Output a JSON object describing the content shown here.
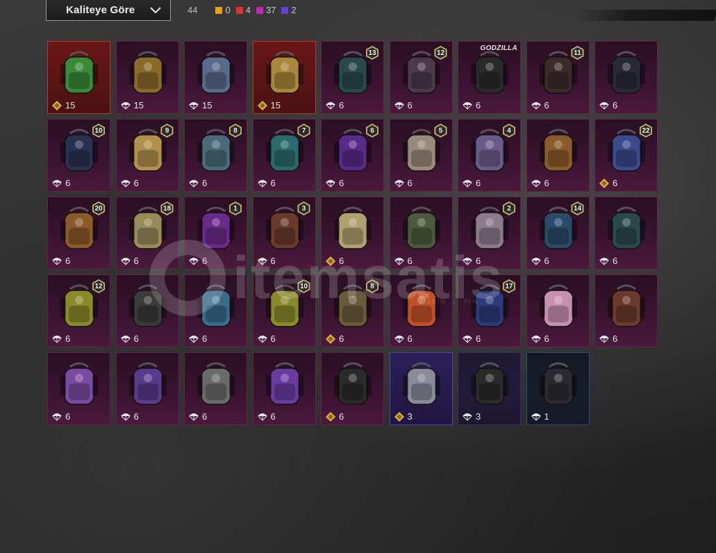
{
  "toolbar": {
    "sort_label": "Kaliteye Göre",
    "total_count": "44",
    "quality_counts": [
      {
        "color": "#e6a21a",
        "count": "0"
      },
      {
        "color": "#e03030",
        "count": "4"
      },
      {
        "color": "#c02ab8",
        "count": "37"
      },
      {
        "color": "#6a3cd8",
        "count": "2"
      }
    ]
  },
  "watermark": {
    "text": "itemsatis",
    "sub": "/ SKIN … -PIN"
  },
  "items": [
    {
      "rarity": "mythic",
      "count": "15",
      "footer_icon": "gold-coin-icon",
      "level": "",
      "label": "",
      "bag_color": "#3a8a3a"
    },
    {
      "rarity": "pink",
      "count": "15",
      "footer_icon": "parachute-icon",
      "level": "",
      "label": "",
      "bag_color": "#8a6a2a"
    },
    {
      "rarity": "pink",
      "count": "15",
      "footer_icon": "parachute-icon",
      "level": "",
      "label": "",
      "bag_color": "#5a6a8a"
    },
    {
      "rarity": "mythic",
      "count": "15",
      "footer_icon": "gold-coin-icon",
      "level": "",
      "label": "",
      "bag_color": "#a8893a"
    },
    {
      "rarity": "pink",
      "count": "6",
      "footer_icon": "parachute-icon",
      "level": "13",
      "label": "",
      "bag_color": "#2a4a4a"
    },
    {
      "rarity": "pink",
      "count": "6",
      "footer_icon": "parachute-icon",
      "level": "12",
      "label": "",
      "bag_color": "#4a3a4a"
    },
    {
      "rarity": "pink",
      "count": "6",
      "footer_icon": "parachute-icon",
      "level": "",
      "label": "GODZILLA",
      "bag_color": "#2a2a2a"
    },
    {
      "rarity": "pink",
      "count": "6",
      "footer_icon": "parachute-icon",
      "level": "11",
      "label": "",
      "bag_color": "#3a2a2a"
    },
    {
      "rarity": "pink",
      "count": "6",
      "footer_icon": "parachute-icon",
      "level": "",
      "label": "",
      "bag_color": "#2a2a34"
    },
    {
      "rarity": "pink",
      "count": "6",
      "footer_icon": "parachute-icon",
      "level": "10",
      "label": "",
      "bag_color": "#2a3050"
    },
    {
      "rarity": "pink",
      "count": "6",
      "footer_icon": "parachute-icon",
      "level": "9",
      "label": "",
      "bag_color": "#b0904a"
    },
    {
      "rarity": "pink",
      "count": "6",
      "footer_icon": "parachute-icon",
      "level": "8",
      "label": "",
      "bag_color": "#4a6a7a"
    },
    {
      "rarity": "pink",
      "count": "6",
      "footer_icon": "parachute-icon",
      "level": "7",
      "label": "",
      "bag_color": "#2a6a6a"
    },
    {
      "rarity": "pink",
      "count": "6",
      "footer_icon": "parachute-icon",
      "level": "6",
      "label": "",
      "bag_color": "#5a2a8a"
    },
    {
      "rarity": "pink",
      "count": "6",
      "footer_icon": "parachute-icon",
      "level": "5",
      "label": "",
      "bag_color": "#9a8a7a"
    },
    {
      "rarity": "pink",
      "count": "6",
      "footer_icon": "parachute-icon",
      "level": "4",
      "label": "",
      "bag_color": "#6a5a8a"
    },
    {
      "rarity": "pink",
      "count": "6",
      "footer_icon": "parachute-icon",
      "level": "",
      "label": "",
      "bag_color": "#8a5a2a"
    },
    {
      "rarity": "pink",
      "count": "6",
      "footer_icon": "gold-coin-icon",
      "level": "22",
      "label": "",
      "bag_color": "#3a4a8a"
    },
    {
      "rarity": "pink",
      "count": "6",
      "footer_icon": "parachute-icon",
      "level": "20",
      "label": "",
      "bag_color": "#8a5a2a"
    },
    {
      "rarity": "pink",
      "count": "6",
      "footer_icon": "parachute-icon",
      "level": "18",
      "label": "",
      "bag_color": "#9a8a5a"
    },
    {
      "rarity": "pink",
      "count": "6",
      "footer_icon": "parachute-icon",
      "level": "1",
      "label": "",
      "bag_color": "#6a2a8a"
    },
    {
      "rarity": "pink",
      "count": "6",
      "footer_icon": "parachute-icon",
      "level": "3",
      "label": "",
      "bag_color": "#6a3a2a"
    },
    {
      "rarity": "pink",
      "count": "6",
      "footer_icon": "gold-coin-icon",
      "level": "",
      "label": "",
      "bag_color": "#b0a070"
    },
    {
      "rarity": "pink",
      "count": "6",
      "footer_icon": "parachute-icon",
      "level": "",
      "label": "",
      "bag_color": "#4a5a3a"
    },
    {
      "rarity": "pink",
      "count": "6",
      "footer_icon": "parachute-icon",
      "level": "2",
      "label": "",
      "bag_color": "#8a7a8a"
    },
    {
      "rarity": "pink",
      "count": "6",
      "footer_icon": "parachute-icon",
      "level": "14",
      "label": "",
      "bag_color": "#2a4a6a"
    },
    {
      "rarity": "pink",
      "count": "6",
      "footer_icon": "parachute-icon",
      "level": "",
      "label": "",
      "bag_color": "#2a4a4a"
    },
    {
      "rarity": "pink",
      "count": "6",
      "footer_icon": "parachute-icon",
      "level": "12",
      "label": "",
      "bag_color": "#8a8a2a"
    },
    {
      "rarity": "pink",
      "count": "6",
      "footer_icon": "parachute-icon",
      "level": "",
      "label": "",
      "bag_color": "#3a3a3a"
    },
    {
      "rarity": "pink",
      "count": "6",
      "footer_icon": "parachute-icon",
      "level": "",
      "label": "",
      "bag_color": "#3a6a8a"
    },
    {
      "rarity": "pink",
      "count": "6",
      "footer_icon": "parachute-icon",
      "level": "10",
      "label": "",
      "bag_color": "#8a8a2a"
    },
    {
      "rarity": "pink",
      "count": "6",
      "footer_icon": "gold-coin-icon",
      "level": "8",
      "label": "",
      "bag_color": "#6a5a3a"
    },
    {
      "rarity": "pink",
      "count": "6",
      "footer_icon": "parachute-icon",
      "level": "",
      "label": "",
      "bag_color": "#c0502a"
    },
    {
      "rarity": "pink",
      "count": "6",
      "footer_icon": "parachute-icon",
      "level": "17",
      "label": "",
      "bag_color": "#2a3a7a"
    },
    {
      "rarity": "pink",
      "count": "6",
      "footer_icon": "parachute-icon",
      "level": "",
      "label": "",
      "bag_color": "#c890b0"
    },
    {
      "rarity": "pink",
      "count": "6",
      "footer_icon": "parachute-icon",
      "level": "",
      "label": "",
      "bag_color": "#6a3a2a"
    },
    {
      "rarity": "pink",
      "count": "6",
      "footer_icon": "parachute-icon",
      "level": "",
      "label": "",
      "bag_color": "#7a4aa0"
    },
    {
      "rarity": "pink",
      "count": "6",
      "footer_icon": "parachute-icon",
      "level": "",
      "label": "",
      "bag_color": "#5a3a8a"
    },
    {
      "rarity": "pink",
      "count": "6",
      "footer_icon": "parachute-icon",
      "level": "",
      "label": "",
      "bag_color": "#6a6a6a"
    },
    {
      "rarity": "pink",
      "count": "6",
      "footer_icon": "parachute-icon",
      "level": "",
      "label": "",
      "bag_color": "#6a3aa0"
    },
    {
      "rarity": "pink",
      "count": "6",
      "footer_icon": "gold-coin-icon",
      "level": "",
      "label": "",
      "bag_color": "#2a2a2a"
    },
    {
      "rarity": "purple",
      "count": "3",
      "footer_icon": "gold-coin-icon",
      "level": "",
      "label": "",
      "bag_color": "#8a8a9a"
    },
    {
      "rarity": "darkpurple",
      "count": "3",
      "footer_icon": "parachute-icon",
      "level": "",
      "label": "",
      "bag_color": "#2a2a2a"
    },
    {
      "rarity": "blue",
      "count": "1",
      "footer_icon": "parachute-icon",
      "level": "",
      "label": "",
      "bag_color": "#2a2a30"
    }
  ]
}
